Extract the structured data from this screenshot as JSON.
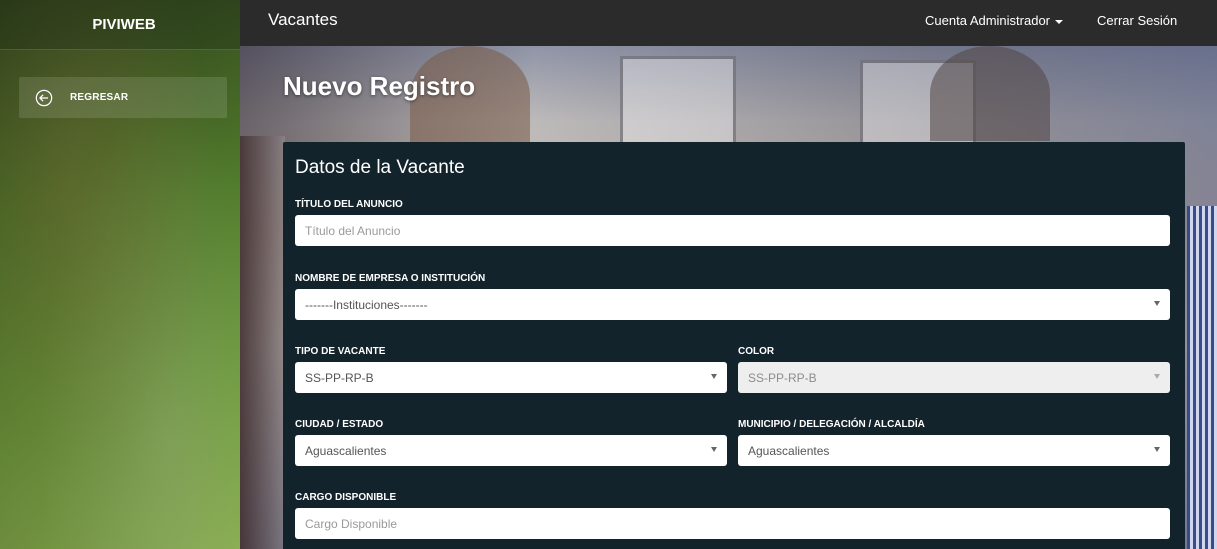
{
  "sidebar": {
    "brand": "PIVIWEB",
    "back_label": "REGRESAR"
  },
  "topbar": {
    "title": "Vacantes",
    "account": "Cuenta Administrador",
    "logout": "Cerrar Sesión"
  },
  "page": {
    "title": "Nuevo Registro"
  },
  "form": {
    "title": "Datos de la Vacante",
    "titulo_anuncio": {
      "label": "TÍTULO DEL ANUNCIO",
      "placeholder": "Título del Anuncio"
    },
    "empresa": {
      "label": "NOMBRE DE EMPRESA O INSTITUCIÓN",
      "value": "-------Instituciones-------"
    },
    "tipo_vacante": {
      "label": "TIPO DE VACANTE",
      "value": "SS-PP-RP-B"
    },
    "color": {
      "label": "COLOR",
      "value": "SS-PP-RP-B"
    },
    "ciudad": {
      "label": "CIUDAD / ESTADO",
      "value": "Aguascalientes"
    },
    "municipio": {
      "label": "MUNICIPIO / DELEGACIÓN / ALCALDÍA",
      "value": "Aguascalientes"
    },
    "cargo": {
      "label": "CARGO DISPONIBLE",
      "placeholder": "Cargo Disponible"
    }
  },
  "icons": {
    "back": "arrow-left-circle-icon",
    "dropdown": "caret-down-icon"
  }
}
